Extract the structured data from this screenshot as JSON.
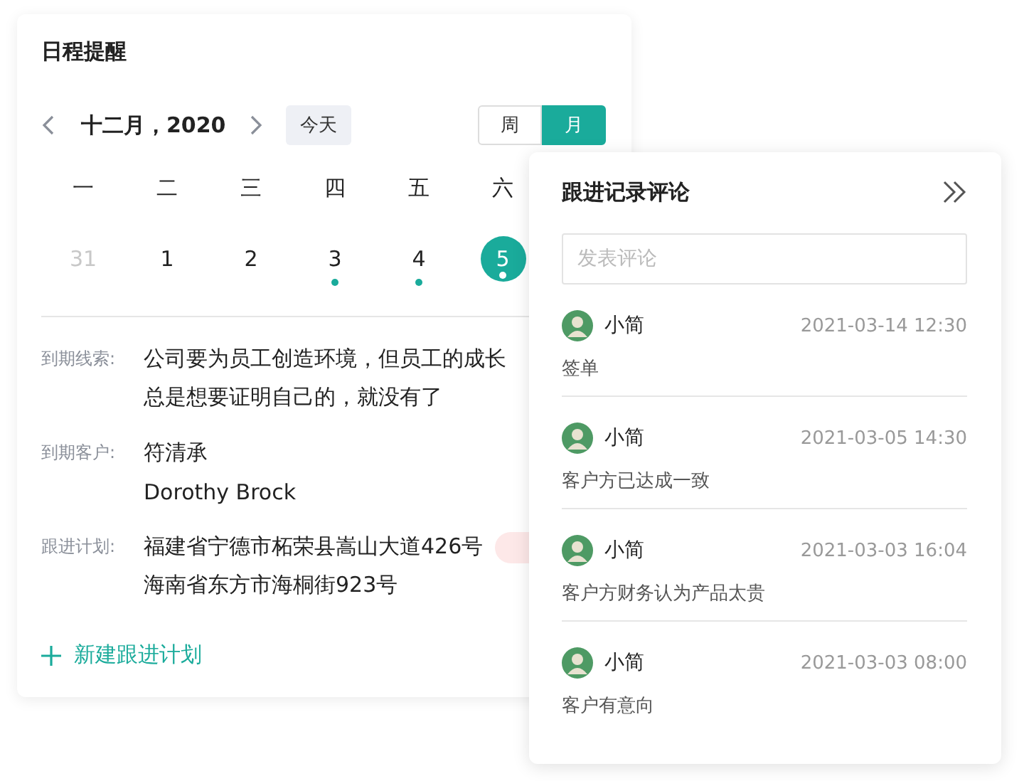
{
  "schedule": {
    "title": "日程提醒",
    "month_label": "十二月，2020",
    "today_button": "今天",
    "view_toggle": [
      {
        "label": "周",
        "selected": false
      },
      {
        "label": "月",
        "selected": true
      }
    ],
    "weekdays": [
      "一",
      "二",
      "三",
      "四",
      "五",
      "六"
    ],
    "days": [
      {
        "label": "31",
        "outside_month": true,
        "has_event": false,
        "selected": false
      },
      {
        "label": "1",
        "outside_month": false,
        "has_event": false,
        "selected": false
      },
      {
        "label": "2",
        "outside_month": false,
        "has_event": false,
        "selected": false
      },
      {
        "label": "3",
        "outside_month": false,
        "has_event": true,
        "selected": false
      },
      {
        "label": "4",
        "outside_month": false,
        "has_event": true,
        "selected": false
      },
      {
        "label": "5",
        "outside_month": false,
        "has_event": true,
        "selected": true
      }
    ],
    "details": [
      {
        "label": "到期线索:",
        "lines": [
          "公司要为员工创造环境，但员工的成长",
          "总是想要证明自己的，就没有了"
        ],
        "tag": false
      },
      {
        "label": "到期客户:",
        "lines": [
          "符清承",
          "Dorothy Brock"
        ],
        "tag": false
      },
      {
        "label": "跟进计划:",
        "lines": [
          "福建省宁德市柘荣县嵩山大道426号",
          "海南省东方市海桐街923号"
        ],
        "tag": true
      }
    ],
    "add_link": "新建跟进计划"
  },
  "comments_panel": {
    "title": "跟进记录评论",
    "input": {
      "placeholder": "发表评论"
    },
    "comments": [
      {
        "author": "小简",
        "time": "2021-03-14 12:30",
        "text": "签单"
      },
      {
        "author": "小简",
        "time": "2021-03-05 14:30",
        "text": "客户方已达成一致"
      },
      {
        "author": "小简",
        "time": "2021-03-03 16:04",
        "text": "客户方财务认为产品太贵"
      },
      {
        "author": "小简",
        "time": "2021-03-03 08:00",
        "text": "客户有意向"
      }
    ]
  }
}
